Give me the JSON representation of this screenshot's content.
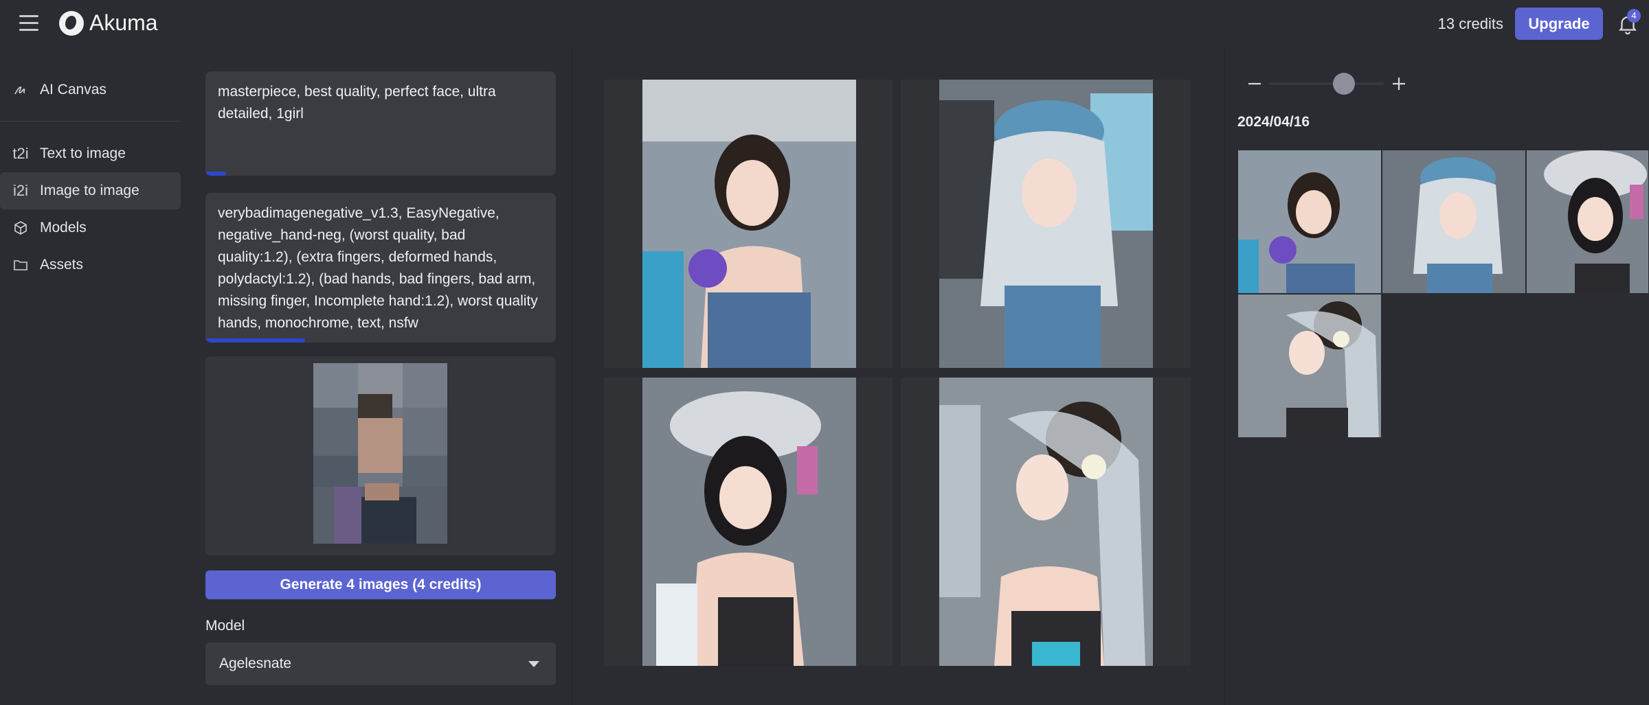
{
  "app": {
    "name": "Akuma",
    "credits": "13 credits",
    "upgrade_label": "Upgrade",
    "notification_count": "4",
    "accent": "#5b64d1"
  },
  "sidebar": {
    "items": [
      {
        "icon": "scribble-icon",
        "label": "AI Canvas"
      },
      {
        "icon": "t2i",
        "label": "Text to image"
      },
      {
        "icon": "i2i",
        "label": "Image to image",
        "active": true
      },
      {
        "icon": "cube-icon",
        "label": "Models"
      },
      {
        "icon": "folder-icon",
        "label": "Assets"
      }
    ]
  },
  "panel": {
    "prompt": "masterpiece, best quality, perfect face, ultra detailed, 1girl",
    "negative_prompt": "verybadimagenegative_v1.3, EasyNegative, negative_hand-neg, (worst quality, bad quality:1.2), (extra fingers, deformed hands, polydactyl:1.2), (bad hands, bad fingers, bad arm, missing finger, Incomplete hand:1.2), worst quality hands, monochrome, text, nsfw",
    "generate_label": "Generate 4 images (4 credits)",
    "model_label": "Model",
    "model_value": "Agelesnate"
  },
  "history": {
    "date": "2024/04/16"
  }
}
